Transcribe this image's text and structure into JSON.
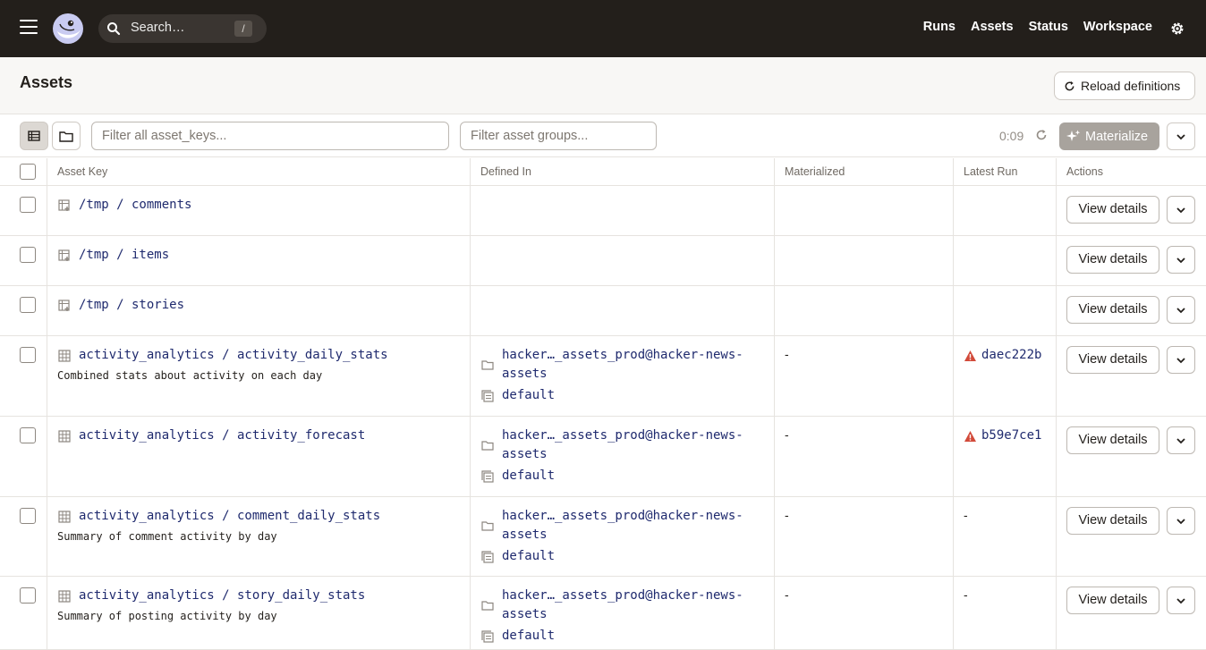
{
  "nav": {
    "search_placeholder": "Search…",
    "search_shortcut": "/",
    "links": [
      "Runs",
      "Assets",
      "Status",
      "Workspace"
    ]
  },
  "page": {
    "title": "Assets",
    "reload_label": "Reload definitions"
  },
  "toolbar": {
    "filter_keys_placeholder": "Filter all asset_keys...",
    "filter_groups_placeholder": "Filter asset groups...",
    "timer": "0:09",
    "materialize_label": "Materialize"
  },
  "table": {
    "headers": [
      "Asset Key",
      "Defined In",
      "Materialized",
      "Latest Run",
      "Actions"
    ],
    "view_details_label": "View details",
    "rows": [
      {
        "key": "/tmp / comments",
        "desc": "",
        "source": false,
        "source_label": "",
        "group": "",
        "materialized": "",
        "run": "",
        "run_failed": false
      },
      {
        "key": "/tmp / items",
        "desc": "",
        "source": false,
        "source_label": "",
        "group": "",
        "materialized": "",
        "run": "",
        "run_failed": false
      },
      {
        "key": "/tmp / stories",
        "desc": "",
        "source": false,
        "source_label": "",
        "group": "",
        "materialized": "",
        "run": "",
        "run_failed": false
      },
      {
        "key": "activity_analytics / activity_daily_stats",
        "desc": "Combined stats about activity on each day",
        "source": true,
        "source_label": "hacker…_assets_prod@hacker-news-assets",
        "group": "default",
        "materialized": "-",
        "run": "daec222b",
        "run_failed": true
      },
      {
        "key": "activity_analytics / activity_forecast",
        "desc": "",
        "source": true,
        "source_label": "hacker…_assets_prod@hacker-news-assets",
        "group": "default",
        "materialized": "-",
        "run": "b59e7ce1",
        "run_failed": true
      },
      {
        "key": "activity_analytics / comment_daily_stats",
        "desc": "Summary of comment activity by day",
        "source": true,
        "source_label": "hacker…_assets_prod@hacker-news-assets",
        "group": "default",
        "materialized": "-",
        "run": "-",
        "run_failed": false
      },
      {
        "key": "activity_analytics / story_daily_stats",
        "desc": "Summary of posting activity by day",
        "source": true,
        "source_label": "hacker…_assets_prod@hacker-news-assets",
        "group": "default",
        "materialized": "-",
        "run": "-",
        "run_failed": false
      }
    ]
  },
  "colors": {
    "nav_bg": "#231f1b",
    "link": "#1f2a6e",
    "warning": "#d24a3a",
    "materialize_bg": "#a8a39d"
  }
}
